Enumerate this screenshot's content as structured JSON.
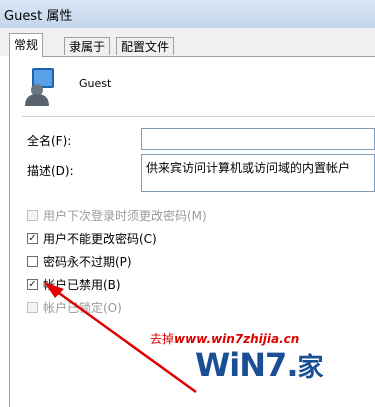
{
  "window": {
    "title": "Guest 属性"
  },
  "tabs": [
    {
      "label": "常规",
      "active": true
    },
    {
      "label": "隶属于",
      "active": false
    },
    {
      "label": "配置文件",
      "active": false
    }
  ],
  "user": {
    "name": "Guest"
  },
  "fields": {
    "fullname_label": "全名(F):",
    "fullname_value": "",
    "desc_label": "描述(D):",
    "desc_value": "供来宾访问计算机或访问域的内置帐户"
  },
  "options": [
    {
      "label": "用户下次登录时须更改密码(M)",
      "checked": false,
      "enabled": false
    },
    {
      "label": "用户不能更改密码(C)",
      "checked": true,
      "enabled": true
    },
    {
      "label": "密码永不过期(P)",
      "checked": false,
      "enabled": true
    },
    {
      "label": "帐户已禁用(B)",
      "checked": true,
      "enabled": true
    },
    {
      "label": "帐户已锁定(O)",
      "checked": false,
      "enabled": false
    }
  ],
  "watermark": {
    "text_before": "去掉",
    "url": "www.win7zhijia.cn",
    "logo": "WiN7.",
    "logo_suffix": "家",
    "accent": "#e00000",
    "logo_color": "#1a4f96"
  }
}
